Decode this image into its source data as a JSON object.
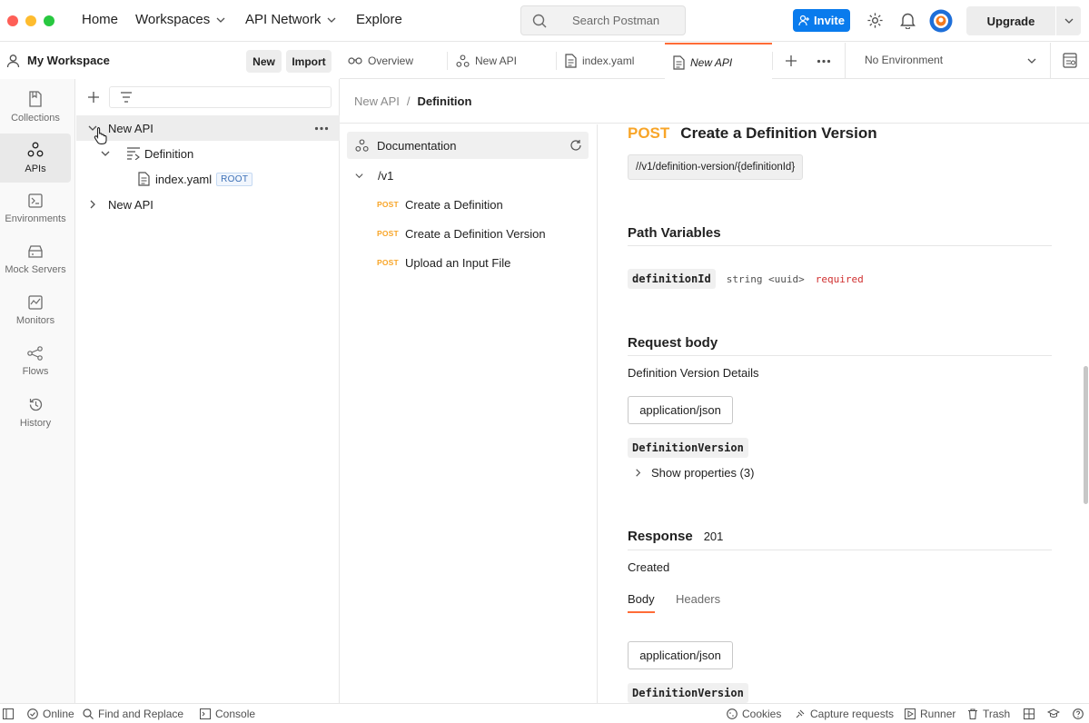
{
  "titlebar": {
    "nav": [
      "Home",
      "Workspaces",
      "API Network",
      "Explore"
    ],
    "search_placeholder": "Search Postman",
    "invite_label": "Invite",
    "upgrade_label": "Upgrade"
  },
  "workspace": {
    "name": "My Workspace",
    "new_label": "New",
    "import_label": "Import"
  },
  "rail": [
    {
      "label": "Collections",
      "icon": "collections-icon"
    },
    {
      "label": "APIs",
      "icon": "apis-icon"
    },
    {
      "label": "Environments",
      "icon": "environments-icon"
    },
    {
      "label": "Mock Servers",
      "icon": "mock-servers-icon"
    },
    {
      "label": "Monitors",
      "icon": "monitors-icon"
    },
    {
      "label": "Flows",
      "icon": "flows-icon"
    },
    {
      "label": "History",
      "icon": "history-icon"
    }
  ],
  "tree": {
    "api1": "New API",
    "definition": "Definition",
    "file": "index.yaml",
    "root_badge": "ROOT",
    "api2": "New API"
  },
  "tabs": [
    {
      "label": "Overview",
      "icon": "overview-icon"
    },
    {
      "label": "New API",
      "icon": "api-icon"
    },
    {
      "label": "index.yaml",
      "icon": "file-icon"
    },
    {
      "label": "New API",
      "icon": "file-icon"
    }
  ],
  "environment": {
    "label": "No Environment"
  },
  "breadcrumb": {
    "parent": "New API",
    "separator": "/",
    "current": "Definition"
  },
  "docnav": {
    "documentation": "Documentation",
    "group": "/v1",
    "endpoints": [
      {
        "method": "POST",
        "name": "Create a Definition"
      },
      {
        "method": "POST",
        "name": "Create a Definition Version"
      },
      {
        "method": "POST",
        "name": "Upload an Input File"
      }
    ]
  },
  "doc": {
    "method": "POST",
    "title": "Create a Definition Version",
    "path": "//v1/definition-version/{definitionId}",
    "path_variables_title": "Path Variables",
    "param_name": "definitionId",
    "param_type": "string <uuid>",
    "param_required": "required",
    "request_body_title": "Request body",
    "request_body_desc": "Definition Version Details",
    "content_type": "application/json",
    "schema_name": "DefinitionVersion",
    "show_properties": "Show properties (3)",
    "response_title": "Response",
    "response_code": "201",
    "response_desc": "Created",
    "response_tabs": [
      "Body",
      "Headers"
    ],
    "response_content_type": "application/json",
    "response_schema": "DefinitionVersion"
  },
  "statusbar": {
    "online": "Online",
    "find_replace": "Find and Replace",
    "console": "Console",
    "cookies": "Cookies",
    "capture": "Capture requests",
    "runner": "Runner",
    "trash": "Trash"
  },
  "colors": {
    "accent": "#ff6c37",
    "invite": "#097bed",
    "post": "#f8a528",
    "required": "#d02f2f"
  }
}
